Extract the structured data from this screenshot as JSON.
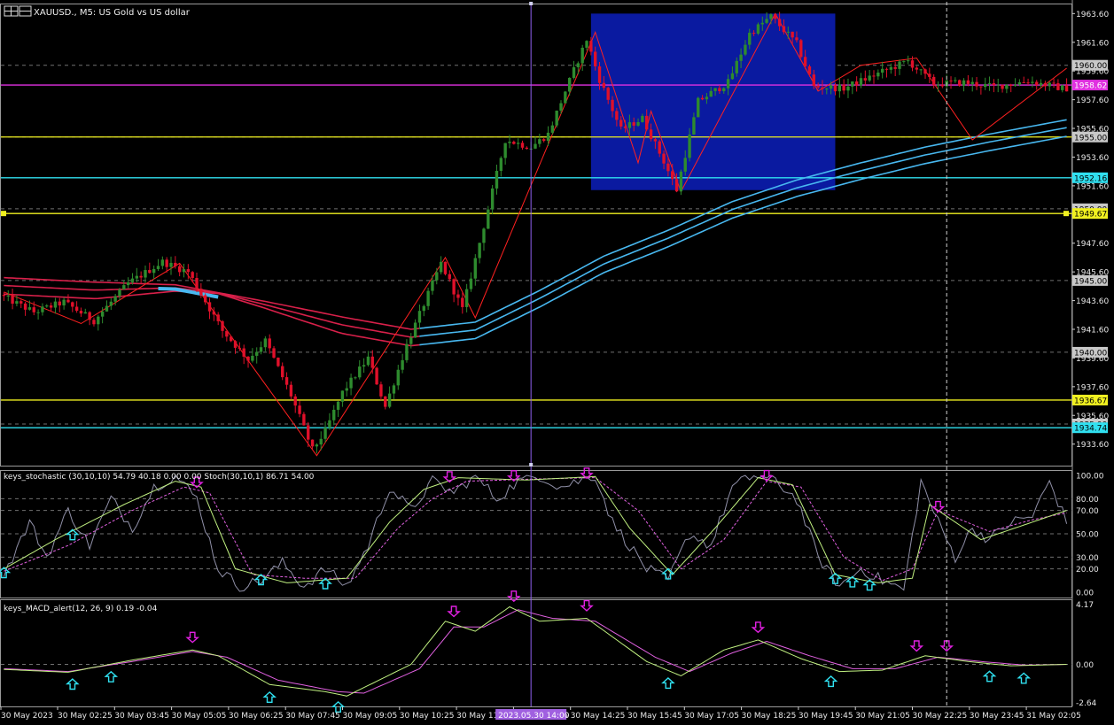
{
  "header": {
    "symbol_title": "XAUUSD., M5:  US Gold vs US dollar"
  },
  "colors": {
    "background": "#000000",
    "bull_candle": "#2e8b2e",
    "bear_candle": "#e0102a",
    "ema_red": "#d8204a",
    "ema_blue": "#48b8f0",
    "zigzag": "#ff2020",
    "magenta_line": "#e030e0",
    "yellow_line": "#f0f020",
    "cyan_line": "#30e0f0",
    "box": "#0a1aa0",
    "stoch_main": "#c0f080",
    "stoch_signal": "#e060e0",
    "stoch_raw": "#9090a8",
    "arrow_down": "#e020e0",
    "arrow_up": "#30e0f0",
    "grid": "#707070"
  },
  "main_axis": {
    "ticks": [
      "1963.60",
      "1961.60",
      "1959.60",
      "1957.60",
      "1955.60",
      "1953.60",
      "1951.60",
      "1947.60",
      "1945.60",
      "1943.60",
      "1941.60",
      "1939.60",
      "1937.60",
      "1935.60",
      "1933.60"
    ],
    "tick_values": [
      1963.6,
      1961.6,
      1959.6,
      1957.6,
      1955.6,
      1953.6,
      1951.6,
      1947.6,
      1945.6,
      1943.6,
      1941.6,
      1939.6,
      1937.6,
      1935.6,
      1933.6
    ],
    "range": [
      1932.1,
      1964.3
    ],
    "boxed_labels": [
      {
        "text": "1960.00",
        "value": 1960.0,
        "bg": "#c8c8c8",
        "fg": "#000"
      },
      {
        "text": "1958.62",
        "value": 1958.62,
        "bg": "#e030e0",
        "fg": "#fff"
      },
      {
        "text": "1955.00",
        "value": 1955.0,
        "bg": "#c8c8c8",
        "fg": "#000"
      },
      {
        "text": "1952.16",
        "value": 1952.16,
        "bg": "#30e0f0",
        "fg": "#000"
      },
      {
        "text": "1950.00",
        "value": 1950.0,
        "bg": "#c8c8c8",
        "fg": "#000"
      },
      {
        "text": "1949.67",
        "value": 1949.67,
        "bg": "#f0f020",
        "fg": "#000"
      },
      {
        "text": "1945.00",
        "value": 1945.0,
        "bg": "#c8c8c8",
        "fg": "#000"
      },
      {
        "text": "1940.00",
        "value": 1940.0,
        "bg": "#c8c8c8",
        "fg": "#000"
      },
      {
        "text": "1936.67",
        "value": 1936.67,
        "bg": "#f0f020",
        "fg": "#000"
      },
      {
        "text": "1935.00",
        "value": 1935.0,
        "bg": "#c8c8c8",
        "fg": "#000"
      },
      {
        "text": "1934.74",
        "value": 1934.74,
        "bg": "#30e0f0",
        "fg": "#000"
      }
    ]
  },
  "stoch_panel": {
    "title": "keys_stochastic (30,10,10) 54.79 40.18 0.00 0.00 Stoch(30,10,1) 86.71 54.00",
    "ticks": [
      "100.00",
      "80.00",
      "70.00",
      "50.00",
      "30.00",
      "20.00",
      "0.00"
    ],
    "tick_values": [
      100,
      80,
      70,
      50,
      30,
      20,
      0
    ]
  },
  "macd_panel": {
    "title": "keys_MACD_alert(12, 26, 9) 0.19 -0.04",
    "ticks": [
      "4.17",
      "0.00",
      "-2.64"
    ],
    "tick_values": [
      4.17,
      0.0,
      -2.64
    ]
  },
  "time_axis": {
    "labels": [
      "30 May 2023",
      "30 May 02:25",
      "30 May 03:45",
      "30 May 05:05",
      "30 May 06:25",
      "30 May 07:45",
      "30 May 09:05",
      "30 May 10:25",
      "30 May 11:45",
      "30 May 13:05",
      "30 May 14:25",
      "30 May 15:45",
      "30 May 17:05",
      "30 May 18:25",
      "30 May 19:45",
      "30 May 21:05",
      "30 May 22:25",
      "30 May 23:45",
      "31 May 02:05"
    ],
    "crosshair_label": "2023.05.30 14:00"
  },
  "chart_data": {
    "type": "candlestick",
    "symbol": "XAUUSD.",
    "timeframe": "M5",
    "price_waypoints": [
      [
        0,
        1944.0
      ],
      [
        8,
        1942.8
      ],
      [
        15,
        1943.5
      ],
      [
        22,
        1942.2
      ],
      [
        30,
        1944.8
      ],
      [
        38,
        1946.3
      ],
      [
        44,
        1945.6
      ],
      [
        52,
        1941.5
      ],
      [
        58,
        1939.5
      ],
      [
        62,
        1940.8
      ],
      [
        68,
        1937.0
      ],
      [
        73,
        1933.2
      ],
      [
        76,
        1934.5
      ],
      [
        80,
        1937.2
      ],
      [
        86,
        1939.6
      ],
      [
        90,
        1936.2
      ],
      [
        95,
        1940.5
      ],
      [
        103,
        1946.2
      ],
      [
        108,
        1943.0
      ],
      [
        113,
        1948.8
      ],
      [
        118,
        1954.8
      ],
      [
        124,
        1954.3
      ],
      [
        128,
        1955.2
      ],
      [
        132,
        1958.2
      ],
      [
        137,
        1961.8
      ],
      [
        140,
        1959.0
      ],
      [
        145,
        1955.5
      ],
      [
        150,
        1956.3
      ],
      [
        155,
        1953.3
      ],
      [
        158,
        1951.3
      ],
      [
        163,
        1957.5
      ],
      [
        170,
        1958.8
      ],
      [
        175,
        1962.2
      ],
      [
        180,
        1963.4
      ],
      [
        186,
        1961.5
      ],
      [
        190,
        1958.5
      ],
      [
        197,
        1958.4
      ],
      [
        204,
        1959.3
      ],
      [
        212,
        1960.3
      ],
      [
        218,
        1958.7
      ],
      [
        225,
        1958.8
      ],
      [
        232,
        1958.5
      ],
      [
        240,
        1958.9
      ],
      [
        248,
        1958.4
      ]
    ],
    "horizontal_levels": [
      {
        "value": 1958.62,
        "color": "magenta"
      },
      {
        "value": 1955.0,
        "color": "yellow"
      },
      {
        "value": 1952.16,
        "color": "cyan"
      },
      {
        "value": 1949.67,
        "color": "yellow"
      },
      {
        "value": 1936.67,
        "color": "yellow"
      },
      {
        "value": 1934.74,
        "color": "cyan"
      }
    ],
    "grid_levels": [
      1960.0,
      1955.0,
      1950.0,
      1945.0,
      1940.0,
      1935.0
    ],
    "box": {
      "from_bar": 137,
      "to_bar": 194,
      "high": 1963.6,
      "low": 1951.3
    },
    "zigzag": [
      [
        0,
        1944.2
      ],
      [
        18,
        1942.0
      ],
      [
        41,
        1946.2
      ],
      [
        58,
        1939.0
      ],
      [
        73,
        1932.8
      ],
      [
        103,
        1946.6
      ],
      [
        110,
        1942.4
      ],
      [
        138,
        1962.3
      ],
      [
        148,
        1953.2
      ],
      [
        151,
        1956.8
      ],
      [
        158,
        1951.2
      ],
      [
        180,
        1963.6
      ],
      [
        190,
        1958.2
      ],
      [
        200,
        1960.0
      ],
      [
        213,
        1960.5
      ],
      [
        226,
        1954.8
      ],
      [
        248,
        1959.8
      ]
    ],
    "ema_waypoints": [
      [
        0,
        1945.2
      ],
      [
        20,
        1944.9
      ],
      [
        40,
        1944.7
      ],
      [
        60,
        1943.6
      ],
      [
        80,
        1942.4
      ],
      [
        95,
        1941.6
      ],
      [
        110,
        1942.1
      ],
      [
        125,
        1944.3
      ],
      [
        140,
        1946.7
      ],
      [
        155,
        1948.5
      ],
      [
        170,
        1950.5
      ],
      [
        185,
        1952.0
      ],
      [
        200,
        1953.2
      ],
      [
        215,
        1954.3
      ],
      [
        230,
        1955.2
      ],
      [
        248,
        1956.2
      ]
    ],
    "ema_color_switch_bar": 97,
    "stoch_signal_waypoints": [
      [
        0,
        18
      ],
      [
        15,
        40
      ],
      [
        30,
        70
      ],
      [
        42,
        90
      ],
      [
        48,
        85
      ],
      [
        58,
        15
      ],
      [
        70,
        12
      ],
      [
        82,
        12
      ],
      [
        92,
        55
      ],
      [
        100,
        80
      ],
      [
        108,
        95
      ],
      [
        125,
        97
      ],
      [
        138,
        98
      ],
      [
        148,
        70
      ],
      [
        158,
        20
      ],
      [
        168,
        45
      ],
      [
        178,
        95
      ],
      [
        186,
        90
      ],
      [
        196,
        30
      ],
      [
        205,
        10
      ],
      [
        212,
        20
      ],
      [
        218,
        70
      ],
      [
        230,
        52
      ],
      [
        240,
        62
      ],
      [
        248,
        68
      ]
    ],
    "stoch_main_waypoints": [
      [
        0,
        20
      ],
      [
        12,
        45
      ],
      [
        28,
        75
      ],
      [
        40,
        95
      ],
      [
        46,
        90
      ],
      [
        54,
        20
      ],
      [
        66,
        8
      ],
      [
        80,
        12
      ],
      [
        90,
        60
      ],
      [
        98,
        88
      ],
      [
        106,
        98
      ],
      [
        122,
        96
      ],
      [
        138,
        99
      ],
      [
        146,
        55
      ],
      [
        156,
        15
      ],
      [
        166,
        55
      ],
      [
        176,
        98
      ],
      [
        184,
        92
      ],
      [
        194,
        15
      ],
      [
        204,
        8
      ],
      [
        212,
        12
      ],
      [
        216,
        75
      ],
      [
        228,
        45
      ],
      [
        240,
        60
      ],
      [
        248,
        70
      ]
    ],
    "stoch_raw_waypoints": [
      [
        0,
        15
      ],
      [
        6,
        60
      ],
      [
        10,
        30
      ],
      [
        15,
        70
      ],
      [
        20,
        40
      ],
      [
        25,
        80
      ],
      [
        30,
        55
      ],
      [
        35,
        90
      ],
      [
        40,
        100
      ],
      [
        45,
        80
      ],
      [
        50,
        20
      ],
      [
        55,
        5
      ],
      [
        60,
        10
      ],
      [
        65,
        25
      ],
      [
        70,
        5
      ],
      [
        75,
        20
      ],
      [
        80,
        5
      ],
      [
        85,
        40
      ],
      [
        90,
        90
      ],
      [
        95,
        70
      ],
      [
        100,
        95
      ],
      [
        105,
        85
      ],
      [
        110,
        100
      ],
      [
        115,
        80
      ],
      [
        120,
        95
      ],
      [
        125,
        100
      ],
      [
        130,
        90
      ],
      [
        138,
        100
      ],
      [
        142,
        60
      ],
      [
        146,
        40
      ],
      [
        150,
        20
      ],
      [
        155,
        10
      ],
      [
        160,
        50
      ],
      [
        165,
        40
      ],
      [
        170,
        90
      ],
      [
        175,
        100
      ],
      [
        180,
        95
      ],
      [
        185,
        80
      ],
      [
        190,
        30
      ],
      [
        195,
        5
      ],
      [
        200,
        20
      ],
      [
        205,
        10
      ],
      [
        210,
        2
      ],
      [
        214,
        95
      ],
      [
        218,
        60
      ],
      [
        222,
        30
      ],
      [
        226,
        55
      ],
      [
        230,
        45
      ],
      [
        235,
        60
      ],
      [
        240,
        65
      ],
      [
        244,
        95
      ],
      [
        248,
        60
      ]
    ],
    "macd_main_waypoints": [
      [
        0,
        -0.35
      ],
      [
        15,
        -0.55
      ],
      [
        30,
        0.3
      ],
      [
        44,
        1.0
      ],
      [
        50,
        0.6
      ],
      [
        62,
        -1.4
      ],
      [
        75,
        -1.9
      ],
      [
        80,
        -2.2
      ],
      [
        95,
        0.0
      ],
      [
        103,
        3.0
      ],
      [
        110,
        2.3
      ],
      [
        118,
        4.0
      ],
      [
        125,
        3.0
      ],
      [
        136,
        3.2
      ],
      [
        150,
        0.2
      ],
      [
        158,
        -0.8
      ],
      [
        168,
        1.0
      ],
      [
        176,
        1.7
      ],
      [
        186,
        0.4
      ],
      [
        195,
        -0.5
      ],
      [
        205,
        -0.4
      ],
      [
        215,
        0.6
      ],
      [
        225,
        0.2
      ],
      [
        235,
        -0.1
      ],
      [
        248,
        0.0
      ]
    ],
    "macd_signal_waypoints": [
      [
        0,
        -0.3
      ],
      [
        15,
        -0.5
      ],
      [
        30,
        0.2
      ],
      [
        44,
        0.9
      ],
      [
        52,
        0.5
      ],
      [
        64,
        -1.1
      ],
      [
        78,
        -1.9
      ],
      [
        84,
        -2.0
      ],
      [
        97,
        -0.3
      ],
      [
        105,
        2.6
      ],
      [
        112,
        2.6
      ],
      [
        120,
        3.8
      ],
      [
        128,
        3.2
      ],
      [
        138,
        3.0
      ],
      [
        152,
        0.5
      ],
      [
        160,
        -0.5
      ],
      [
        170,
        0.8
      ],
      [
        178,
        1.6
      ],
      [
        188,
        0.6
      ],
      [
        198,
        -0.3
      ],
      [
        208,
        -0.3
      ],
      [
        218,
        0.5
      ],
      [
        228,
        0.2
      ],
      [
        238,
        -0.05
      ],
      [
        248,
        0.0
      ]
    ],
    "stoch_down_arrows": [
      45,
      104,
      119,
      136,
      178,
      218
    ],
    "stoch_up_arrows": [
      0,
      16,
      60,
      75,
      155,
      194,
      198,
      202
    ],
    "macd_down_arrows": [
      44,
      105,
      119,
      136,
      176,
      213,
      220
    ],
    "macd_up_arrows": [
      16,
      25,
      62,
      78,
      155,
      193,
      230,
      238
    ],
    "crosshair_bar": 123,
    "second_crosshair_bar": 220,
    "bar_count": 249
  }
}
